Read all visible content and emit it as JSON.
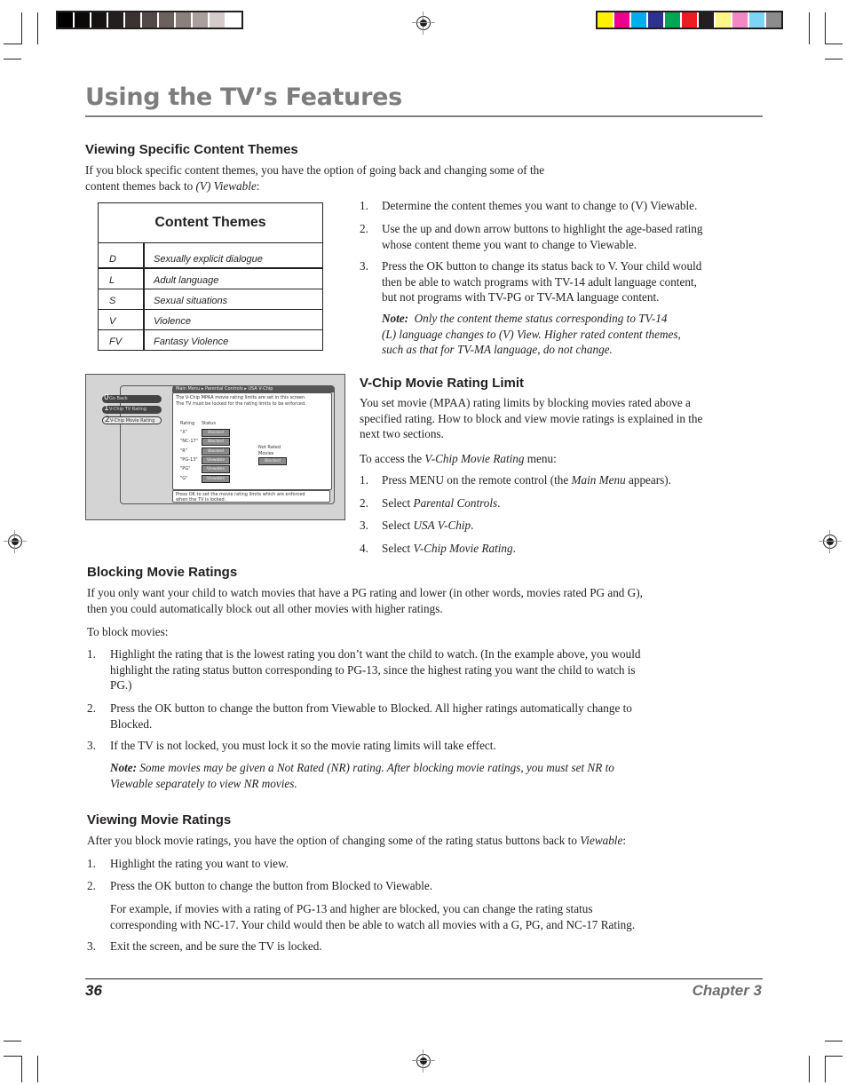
{
  "print_marks": {
    "grayscale_swatches": [
      "#000000",
      "#0b0908",
      "#161312",
      "#231f1e",
      "#3a3331",
      "#524a48",
      "#6b625f",
      "#8a817e",
      "#a9a09e",
      "#d3cccb",
      "#ffffff"
    ],
    "color_swatches": [
      "#fff200",
      "#ec008c",
      "#00aeef",
      "#2e3192",
      "#00a651",
      "#ed1c24",
      "#231f20",
      "#fff685",
      "#f587c4",
      "#7dd5f6",
      "#8c8c8c"
    ]
  },
  "page_title": "Using the TV’s Features",
  "section1": {
    "heading": "Viewing Specific Content Themes",
    "intro_a": "If you block specific content themes, you have the option of going back and changing some of the",
    "intro_b": "content themes back to ",
    "intro_b_italic": "(V) Viewable",
    "intro_b_end": ":",
    "table": {
      "title": "Content Themes",
      "rows": [
        {
          "code": "D",
          "desc": "Sexually explicit dialogue"
        },
        {
          "code": "L",
          "desc": "Adult language"
        },
        {
          "code": "S",
          "desc": "Sexual situations"
        },
        {
          "code": "V",
          "desc": "Violence"
        },
        {
          "code": "FV",
          "desc": "Fantasy Violence"
        }
      ]
    },
    "steps": [
      {
        "num": "1.",
        "lines": [
          "Determine the content themes you want to change to (V) Viewable."
        ]
      },
      {
        "num": "2.",
        "lines": [
          "Use the up and down arrow buttons to highlight the age-based rating",
          "whose content theme you want to change to Viewable."
        ]
      },
      {
        "num": "3.",
        "lines": [
          "Press the OK button to change its status back to V.  Your child would",
          "then be able to watch programs with TV-14 adult language content,",
          "but not programs with TV-PG or TV-MA language content."
        ]
      }
    ],
    "note_label": "Note:",
    "note_lines": [
      "Only the content theme status corresponding to TV-14",
      "(L) language changes to (V) View. Higher rated content themes,",
      "such as that for TV-MA language, do not change."
    ]
  },
  "tv_screen": {
    "menu": [
      {
        "num": "0",
        "label": "Go Back",
        "selected": false
      },
      {
        "num": "1",
        "label": "V-Chip TV Rating",
        "selected": false
      },
      {
        "num": "2",
        "label": "V-Chip Movie Rating",
        "selected": true
      }
    ],
    "breadcrumb": "Main Menu ▸ Parental Controls ▸ USA V-Chip",
    "info_lines": [
      "The V-Chip MPAA movie rating limits are set in this screen.",
      "The TV must be locked for the rating limits to be enforced."
    ],
    "col_rating": "Rating",
    "col_status": "Status",
    "ratings": [
      {
        "rating": "\"X\"",
        "status": "Blocked"
      },
      {
        "rating": "\"NC-17\"",
        "status": "Blocked"
      },
      {
        "rating": "\"R\"",
        "status": "Blocked"
      },
      {
        "rating": "\"PG-13\"",
        "status": "Viewable"
      },
      {
        "rating": "\"PG\"",
        "status": "Viewable"
      },
      {
        "rating": "\"G\"",
        "status": "Viewable"
      }
    ],
    "not_rated_label_1": "Not Rated",
    "not_rated_label_2": "Movies",
    "not_rated_status": "Blocked",
    "footer_lines": [
      "Press OK to set the movie rating limits which are enforced",
      "when the TV is locked."
    ]
  },
  "section2": {
    "heading": "V-Chip Movie Rating Limit",
    "para_lines": [
      "You set movie (MPAA) rating limits by blocking movies rated above a",
      "specified rating. How to block and view movie ratings is explained in the",
      "next two sections."
    ],
    "access_a": "To access the ",
    "access_italic": "V-Chip Movie Rating",
    "access_b": " menu:",
    "steps": [
      {
        "num": "1.",
        "text": "Press MENU on the remote control (the Main Menu appears)."
      },
      {
        "num": "2.",
        "text": "Select Parental Controls."
      },
      {
        "num": "3.",
        "text": "Select USA V-Chip."
      },
      {
        "num": "4.",
        "text": "Select V-Chip Movie Rating."
      }
    ]
  },
  "section3": {
    "heading": "Blocking Movie Ratings",
    "para_lines": [
      "If you only want your child to watch movies that have a PG rating and lower (in other words, movies rated PG and G),",
      "then you could automatically block out all other movies with higher ratings."
    ],
    "lead": "To block movies:",
    "steps": [
      {
        "num": "1.",
        "lines": [
          "Highlight the rating that is the lowest rating you don’t want the child to watch. (In the example above, you would",
          "highlight the rating status button corresponding to PG-13, since the highest rating you want the child to watch is",
          "PG.)"
        ]
      },
      {
        "num": "2.",
        "lines": [
          "Press the OK button to change the button from Viewable to Blocked. All higher ratings automatically change to",
          "Blocked."
        ]
      },
      {
        "num": "3.",
        "lines": [
          "If the TV is not locked, you must lock it so the movie rating limits will take effect."
        ]
      }
    ],
    "note_label": "Note:",
    "note_lines": [
      "Some movies may be given a Not Rated (NR) rating. After blocking movie ratings, you must set NR to",
      "Viewable separately to view NR movies."
    ]
  },
  "section4": {
    "heading": "Viewing Movie Ratings",
    "intro_a": "After you block movie ratings, you have the option of changing some of the rating status buttons back to ",
    "intro_italic": "Viewable",
    "intro_end": ":",
    "steps": [
      {
        "num": "1.",
        "lines": [
          "Highlight the rating you want to view."
        ]
      },
      {
        "num": "2.",
        "lines": [
          "Press the OK button to change the button from Blocked  to Viewable."
        ]
      }
    ],
    "example_lines": [
      "For example, if movies with a rating of PG-13 and higher are blocked, you can change the rating status",
      "corresponding with NC-17. Your child would then be able to watch all movies with a G, PG, and NC-17 Rating."
    ],
    "step3": {
      "num": "3.",
      "text": "Exit the screen, and be sure the TV is locked."
    }
  },
  "footer": {
    "page_number": "36",
    "chapter": "Chapter 3"
  }
}
